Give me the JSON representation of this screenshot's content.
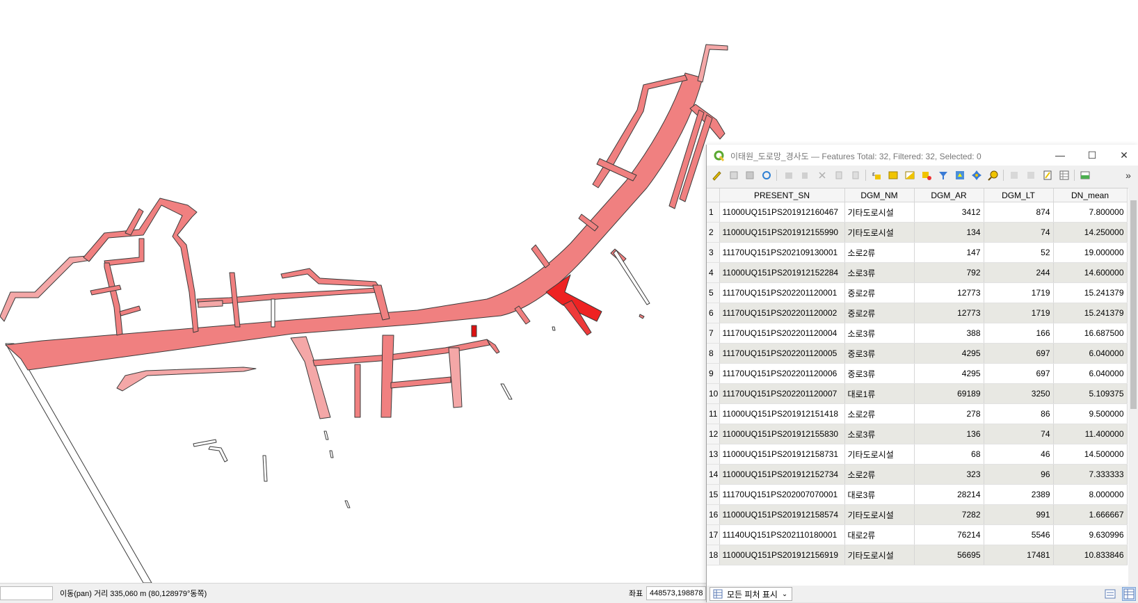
{
  "window": {
    "title": "이태원_도로망_경사도 — Features Total: 32, Filtered: 32, Selected: 0",
    "minimize_label": "—",
    "maximize_label": "☐",
    "close_label": "✕"
  },
  "toolbar": {
    "overflow_label": "»",
    "icons": [
      "edit-pencil-icon",
      "multi-edit-icon",
      "save-edits-icon",
      "reload-icon",
      "add-feature-icon",
      "delete-feature-icon",
      "cut-icon",
      "copy-icon",
      "paste-icon",
      "expression-select-icon",
      "select-all-icon",
      "invert-selection-icon",
      "deselect-all-icon",
      "filter-icon",
      "move-to-top-icon",
      "pan-to-selected-icon",
      "zoom-to-selected-icon",
      "new-field-icon",
      "delete-field-icon",
      "field-calculator-icon",
      "conditional-format-icon",
      "dock-icon"
    ]
  },
  "table": {
    "columns": [
      "PRESENT_SN",
      "DGM_NM",
      "DGM_AR",
      "DGM_LT",
      "DN_mean"
    ],
    "rows": [
      {
        "n": "1",
        "sn": "11000UQ151PS201912160467",
        "nm": "기타도로시설",
        "ar": "3412",
        "lt": "874",
        "mean": "7.800000"
      },
      {
        "n": "2",
        "sn": "11000UQ151PS201912155990",
        "nm": "기타도로시설",
        "ar": "134",
        "lt": "74",
        "mean": "14.250000"
      },
      {
        "n": "3",
        "sn": "11170UQ151PS202109130001",
        "nm": "소로2류",
        "ar": "147",
        "lt": "52",
        "mean": "19.000000"
      },
      {
        "n": "4",
        "sn": "11000UQ151PS201912152284",
        "nm": "소로3류",
        "ar": "792",
        "lt": "244",
        "mean": "14.600000"
      },
      {
        "n": "5",
        "sn": "11170UQ151PS202201120001",
        "nm": "중로2류",
        "ar": "12773",
        "lt": "1719",
        "mean": "15.241379"
      },
      {
        "n": "6",
        "sn": "11170UQ151PS202201120002",
        "nm": "중로2류",
        "ar": "12773",
        "lt": "1719",
        "mean": "15.241379"
      },
      {
        "n": "7",
        "sn": "11170UQ151PS202201120004",
        "nm": "소로3류",
        "ar": "388",
        "lt": "166",
        "mean": "16.687500"
      },
      {
        "n": "8",
        "sn": "11170UQ151PS202201120005",
        "nm": "중로3류",
        "ar": "4295",
        "lt": "697",
        "mean": "6.040000"
      },
      {
        "n": "9",
        "sn": "11170UQ151PS202201120006",
        "nm": "중로3류",
        "ar": "4295",
        "lt": "697",
        "mean": "6.040000"
      },
      {
        "n": "10",
        "sn": "11170UQ151PS202201120007",
        "nm": "대로1류",
        "ar": "69189",
        "lt": "3250",
        "mean": "5.109375"
      },
      {
        "n": "11",
        "sn": "11000UQ151PS201912151418",
        "nm": "소로2류",
        "ar": "278",
        "lt": "86",
        "mean": "9.500000"
      },
      {
        "n": "12",
        "sn": "11000UQ151PS201912155830",
        "nm": "소로3류",
        "ar": "136",
        "lt": "74",
        "mean": "11.400000"
      },
      {
        "n": "13",
        "sn": "11000UQ151PS201912158731",
        "nm": "기타도로시설",
        "ar": "68",
        "lt": "46",
        "mean": "14.500000"
      },
      {
        "n": "14",
        "sn": "11000UQ151PS201912152734",
        "nm": "소로2류",
        "ar": "323",
        "lt": "96",
        "mean": "7.333333"
      },
      {
        "n": "15",
        "sn": "11170UQ151PS202007070001",
        "nm": "대로3류",
        "ar": "28214",
        "lt": "2389",
        "mean": "8.000000"
      },
      {
        "n": "16",
        "sn": "11000UQ151PS201912158574",
        "nm": "기타도로시설",
        "ar": "7282",
        "lt": "991",
        "mean": "1.666667"
      },
      {
        "n": "17",
        "sn": "11140UQ151PS202110180001",
        "nm": "대로2류",
        "ar": "76214",
        "lt": "5546",
        "mean": "9.630996"
      },
      {
        "n": "18",
        "sn": "11000UQ151PS201912156919",
        "nm": "기타도로시설",
        "ar": "56695",
        "lt": "17481",
        "mean": "10.833846"
      }
    ]
  },
  "bottom": {
    "filter_label": "모든 피처 표시",
    "filter_arrow": "⌄"
  },
  "statusbar": {
    "pan_text": "이동(pan) 거리 335,060 m (80,128979°동쪽)",
    "coord_label": "좌표",
    "coord_value": "448573,198878"
  },
  "colors": {
    "road_fill": "#f08080",
    "road_fill_light": "#f4a7a7",
    "road_fill_strong": "#ee2222",
    "road_stroke": "#3a3a3a",
    "row_alt": "#e8e8e3"
  }
}
